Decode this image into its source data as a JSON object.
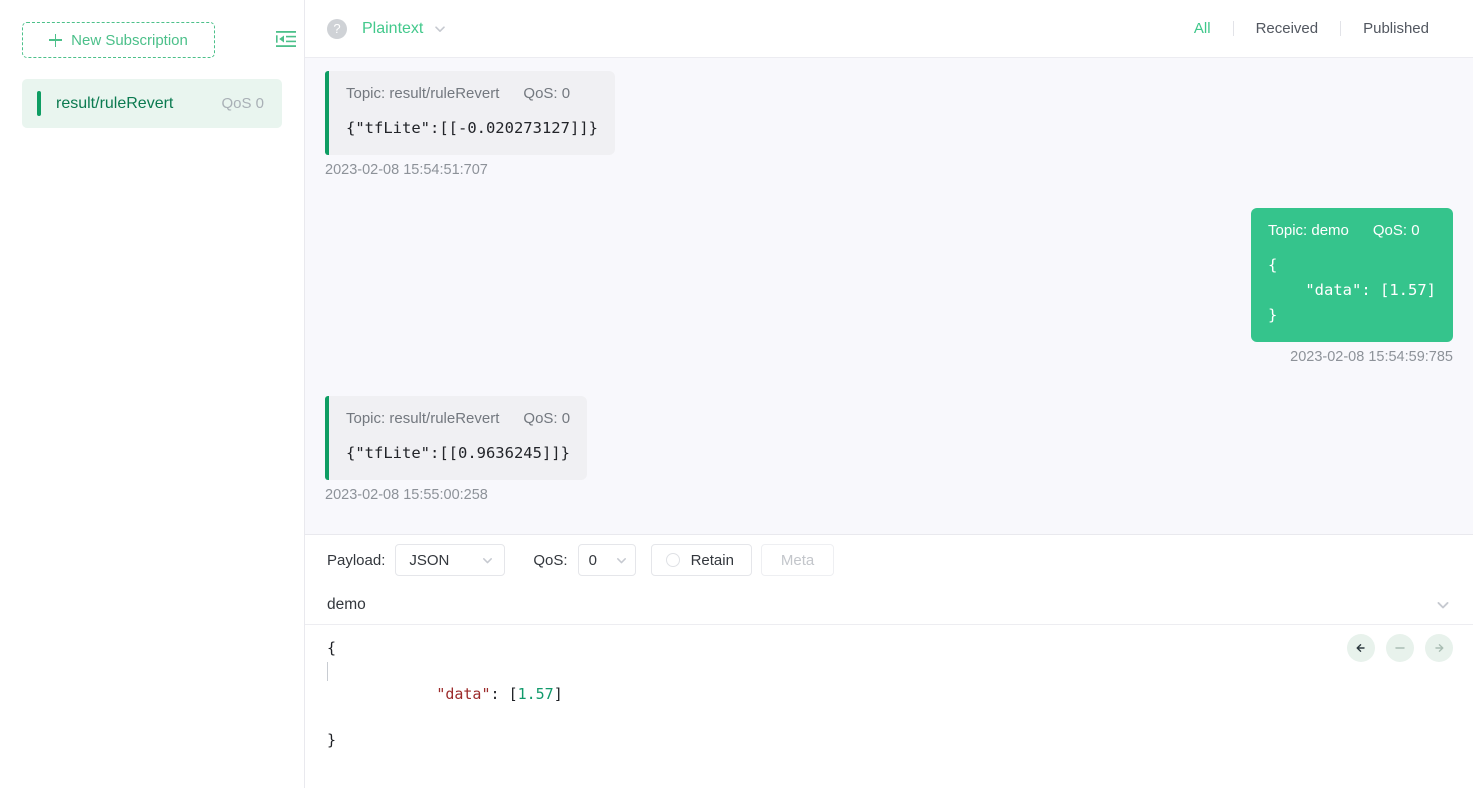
{
  "sidebar": {
    "new_subscription_label": "New Subscription",
    "collapse_icon": "collapse-sidebar-icon",
    "subscriptions": [
      {
        "topic": "result/ruleRevert",
        "qos": "QoS 0"
      }
    ]
  },
  "topbar": {
    "help_icon": "?",
    "format": "Plaintext",
    "tabs": [
      {
        "label": "All",
        "active": true
      },
      {
        "label": "Received",
        "active": false
      },
      {
        "label": "Published",
        "active": false
      }
    ]
  },
  "messages": [
    {
      "direction": "received",
      "topic_label": "Topic: result/ruleRevert",
      "qos_label": "QoS: 0",
      "payload": "{\"tfLite\":[[-0.020273127]]}",
      "time": "2023-02-08 15:54:51:707"
    },
    {
      "direction": "published",
      "topic_label": "Topic: demo",
      "qos_label": "QoS: 0",
      "payload": "{\n    \"data\": [1.57]\n}",
      "time": "2023-02-08 15:54:59:785"
    },
    {
      "direction": "received",
      "topic_label": "Topic: result/ruleRevert",
      "qos_label": "QoS: 0",
      "payload": "{\"tfLite\":[[0.9636245]]}",
      "time": "2023-02-08 15:55:00:258"
    }
  ],
  "publish": {
    "payload_label": "Payload:",
    "payload_value": "JSON",
    "qos_label": "QoS:",
    "qos_value": "0",
    "retain_label": "Retain",
    "retain_checked": false,
    "meta_label": "Meta",
    "topic_value": "demo",
    "editor": {
      "line1": "{",
      "line2_key": "\"data\"",
      "line2_colon": ": ",
      "line2_open": "[",
      "line2_num": "1.57",
      "line2_close": "]",
      "line3": "}"
    },
    "actions": [
      {
        "icon": "arrow-left-icon",
        "state": "enabled"
      },
      {
        "icon": "minus-icon",
        "state": "disabled"
      },
      {
        "icon": "arrow-right-icon",
        "state": "disabled"
      }
    ]
  },
  "colors": {
    "accent_green": "#35c48c",
    "dark_green": "#0e9d63",
    "bubble_gray": "#f0f0f3",
    "panel_bg": "#f8f8fc",
    "key_red": "#9c2b2b",
    "num_green": "#119a6b"
  }
}
